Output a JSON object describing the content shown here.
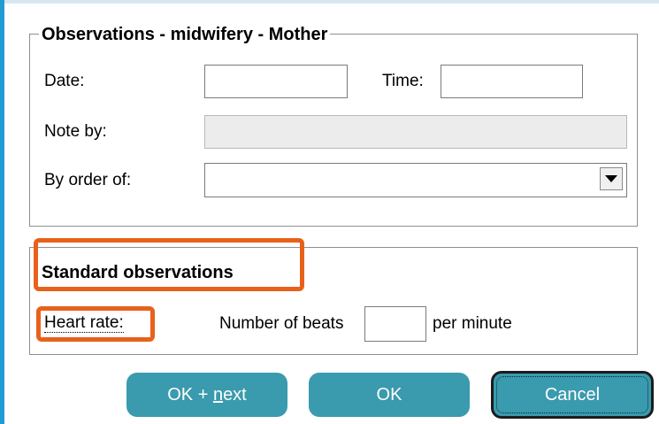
{
  "section_general": {
    "legend": "Observations - midwifery - Mother",
    "date_label": "Date:",
    "date_value": "",
    "time_label": "Time:",
    "time_value": "",
    "note_by_label": "Note by:",
    "note_by_value": "",
    "by_order_of_label": "By order of:",
    "by_order_of_value": ""
  },
  "section_standard": {
    "legend": "Standard observations",
    "heart_rate_label": "Heart rate:",
    "beats_label": "Number of beats",
    "beats_value": "",
    "per_minute_label": "per minute"
  },
  "buttons": {
    "ok_next_prefix": "OK + ",
    "ok_next_mnemonic": "n",
    "ok_next_suffix": "ext",
    "ok_label": "OK",
    "cancel_label": "Cancel"
  },
  "colors": {
    "highlight": "#e8611c",
    "button": "#3a9aae",
    "frame_accent": "#1f9cd2"
  },
  "icons": {
    "dropdown": "chevron-down-icon"
  }
}
